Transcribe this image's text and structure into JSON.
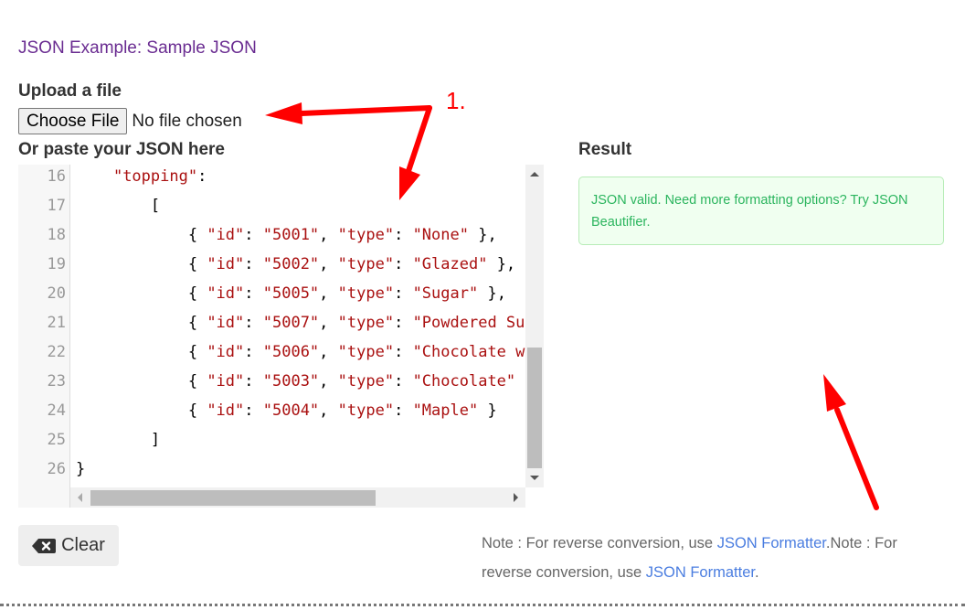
{
  "header": {
    "example_link": "JSON Example: Sample JSON"
  },
  "upload": {
    "label": "Upload a file",
    "choose_button": "Choose File",
    "status": "No file chosen"
  },
  "editor": {
    "label": "Or paste your JSON here",
    "lines": [
      {
        "num": "16",
        "indent": "    ",
        "tokens": [
          {
            "t": "k",
            "v": "\"topping\""
          },
          {
            "t": "p",
            "v": ":"
          }
        ]
      },
      {
        "num": "17",
        "indent": "        ",
        "tokens": [
          {
            "t": "p",
            "v": "["
          }
        ]
      },
      {
        "num": "18",
        "indent": "            ",
        "tokens": [
          {
            "t": "p",
            "v": "{ "
          },
          {
            "t": "k",
            "v": "\"id\""
          },
          {
            "t": "p",
            "v": ": "
          },
          {
            "t": "s",
            "v": "\"5001\""
          },
          {
            "t": "p",
            "v": ", "
          },
          {
            "t": "k",
            "v": "\"type\""
          },
          {
            "t": "p",
            "v": ": "
          },
          {
            "t": "s",
            "v": "\"None\""
          },
          {
            "t": "p",
            "v": " },"
          }
        ]
      },
      {
        "num": "19",
        "indent": "            ",
        "tokens": [
          {
            "t": "p",
            "v": "{ "
          },
          {
            "t": "k",
            "v": "\"id\""
          },
          {
            "t": "p",
            "v": ": "
          },
          {
            "t": "s",
            "v": "\"5002\""
          },
          {
            "t": "p",
            "v": ", "
          },
          {
            "t": "k",
            "v": "\"type\""
          },
          {
            "t": "p",
            "v": ": "
          },
          {
            "t": "s",
            "v": "\"Glazed\""
          },
          {
            "t": "p",
            "v": " },"
          }
        ]
      },
      {
        "num": "20",
        "indent": "            ",
        "tokens": [
          {
            "t": "p",
            "v": "{ "
          },
          {
            "t": "k",
            "v": "\"id\""
          },
          {
            "t": "p",
            "v": ": "
          },
          {
            "t": "s",
            "v": "\"5005\""
          },
          {
            "t": "p",
            "v": ", "
          },
          {
            "t": "k",
            "v": "\"type\""
          },
          {
            "t": "p",
            "v": ": "
          },
          {
            "t": "s",
            "v": "\"Sugar\""
          },
          {
            "t": "p",
            "v": " },"
          }
        ]
      },
      {
        "num": "21",
        "indent": "            ",
        "tokens": [
          {
            "t": "p",
            "v": "{ "
          },
          {
            "t": "k",
            "v": "\"id\""
          },
          {
            "t": "p",
            "v": ": "
          },
          {
            "t": "s",
            "v": "\"5007\""
          },
          {
            "t": "p",
            "v": ", "
          },
          {
            "t": "k",
            "v": "\"type\""
          },
          {
            "t": "p",
            "v": ": "
          },
          {
            "t": "s",
            "v": "\"Powdered Sugar\""
          },
          {
            "t": "p",
            "v": " },"
          }
        ]
      },
      {
        "num": "22",
        "indent": "            ",
        "tokens": [
          {
            "t": "p",
            "v": "{ "
          },
          {
            "t": "k",
            "v": "\"id\""
          },
          {
            "t": "p",
            "v": ": "
          },
          {
            "t": "s",
            "v": "\"5006\""
          },
          {
            "t": "p",
            "v": ", "
          },
          {
            "t": "k",
            "v": "\"type\""
          },
          {
            "t": "p",
            "v": ": "
          },
          {
            "t": "s",
            "v": "\"Chocolate with Sprinkles\""
          },
          {
            "t": "p",
            "v": " },"
          }
        ]
      },
      {
        "num": "23",
        "indent": "            ",
        "tokens": [
          {
            "t": "p",
            "v": "{ "
          },
          {
            "t": "k",
            "v": "\"id\""
          },
          {
            "t": "p",
            "v": ": "
          },
          {
            "t": "s",
            "v": "\"5003\""
          },
          {
            "t": "p",
            "v": ", "
          },
          {
            "t": "k",
            "v": "\"type\""
          },
          {
            "t": "p",
            "v": ": "
          },
          {
            "t": "s",
            "v": "\"Chocolate\""
          },
          {
            "t": "p",
            "v": " },"
          }
        ]
      },
      {
        "num": "24",
        "indent": "            ",
        "tokens": [
          {
            "t": "p",
            "v": "{ "
          },
          {
            "t": "k",
            "v": "\"id\""
          },
          {
            "t": "p",
            "v": ": "
          },
          {
            "t": "s",
            "v": "\"5004\""
          },
          {
            "t": "p",
            "v": ", "
          },
          {
            "t": "k",
            "v": "\"type\""
          },
          {
            "t": "p",
            "v": ": "
          },
          {
            "t": "s",
            "v": "\"Maple\""
          },
          {
            "t": "p",
            "v": " }"
          }
        ]
      },
      {
        "num": "25",
        "indent": "        ",
        "tokens": [
          {
            "t": "p",
            "v": "]"
          }
        ]
      },
      {
        "num": "26",
        "indent": "",
        "tokens": [
          {
            "t": "p",
            "v": "}"
          }
        ]
      }
    ]
  },
  "result": {
    "label": "Result",
    "message": "JSON valid. Need more formatting options? Try JSON Beautifier."
  },
  "actions": {
    "clear_label": "Clear",
    "clear_icon": "backspace-icon"
  },
  "note": {
    "prefix1": "Note : For reverse conversion, use ",
    "link1": "JSON Formatter",
    "mid": ".Note : For reverse conversion, use ",
    "link2": "JSON Formatter",
    "suffix": "."
  },
  "annotations": {
    "step_label": "1.",
    "arrow_color": "#ff0000"
  },
  "colors": {
    "link_purple": "#6a2c91",
    "success_green": "#2bb55e",
    "link_blue": "#4a7de0",
    "json_key": "#aa1111"
  }
}
